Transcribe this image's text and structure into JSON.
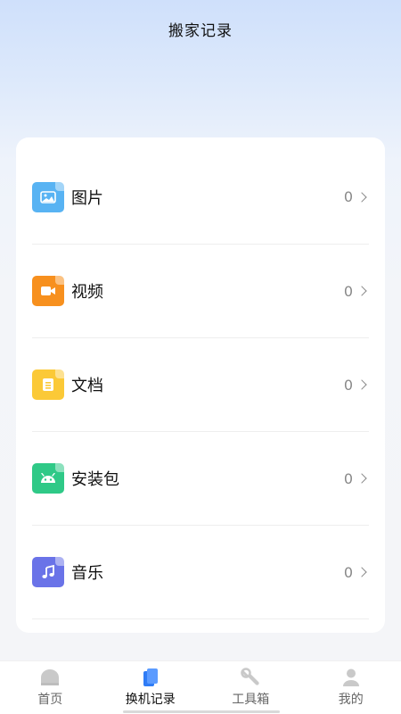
{
  "header": {
    "title": "搬家记录"
  },
  "colors": {
    "image": "#58b3f3",
    "video": "#f7901e",
    "document": "#fbc937",
    "package": "#2fc987",
    "music": "#6a73e8",
    "tab_active": "#2f7cf6",
    "tab_inactive": "#c9c9c9"
  },
  "records": [
    {
      "label": "图片",
      "count": "0",
      "icon": "image-file-icon"
    },
    {
      "label": "视频",
      "count": "0",
      "icon": "video-file-icon"
    },
    {
      "label": "文档",
      "count": "0",
      "icon": "document-file-icon"
    },
    {
      "label": "安装包",
      "count": "0",
      "icon": "android-package-icon"
    },
    {
      "label": "音乐",
      "count": "0",
      "icon": "music-file-icon"
    }
  ],
  "tabs": [
    {
      "label": "首页",
      "icon": "home-icon"
    },
    {
      "label": "换机记录",
      "icon": "record-icon"
    },
    {
      "label": "工具箱",
      "icon": "wrench-icon"
    },
    {
      "label": "我的",
      "icon": "user-icon"
    }
  ]
}
